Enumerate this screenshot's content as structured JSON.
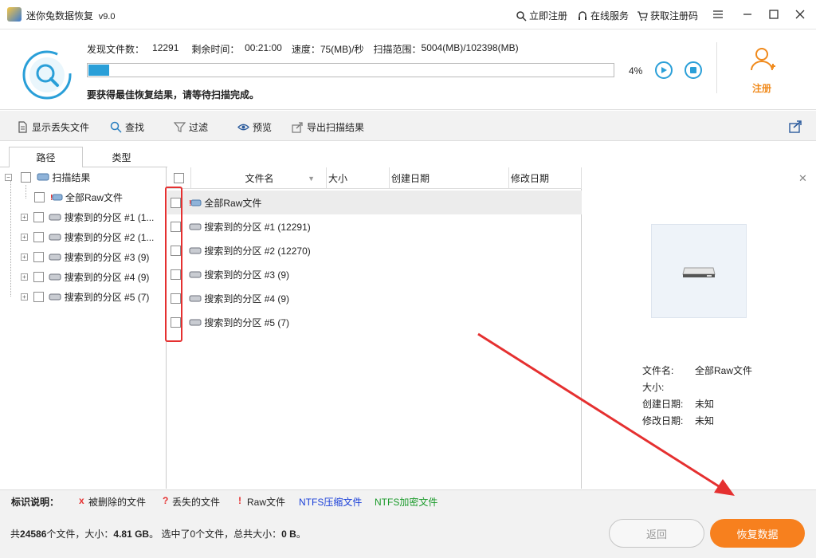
{
  "window": {
    "title": "迷你兔数据恢复",
    "version": "v9.0"
  },
  "title_links": {
    "register": "立即注册",
    "online_service": "在线服务",
    "get_code": "获取注册码"
  },
  "scan": {
    "found_label": "发现文件数：",
    "found_value": "12291",
    "remaining_label": "剩余时间：",
    "remaining_value": "00:21:00",
    "speed_label": "速度：",
    "speed_value": "75(MB)/秒",
    "range_label": "扫描范围：",
    "range_value": "5004(MB)/102398(MB)",
    "progress": 0.04,
    "progress_text": "4%",
    "hint": "要获得最佳恢复结果，请等待扫描完成。"
  },
  "register_label": "注册",
  "toolbar": {
    "show_lost": "显示丢失文件",
    "find": "查找",
    "filter": "过滤",
    "preview": "预览",
    "export": "导出扫描结果"
  },
  "tabs": {
    "path": "路径",
    "type": "类型"
  },
  "tree": {
    "root": "扫描结果",
    "items": [
      "全部Raw文件",
      "搜索到的分区 #1 (1...",
      "搜索到的分区 #2 (1...",
      "搜索到的分区 #3 (9)",
      "搜索到的分区 #4 (9)",
      "搜索到的分区 #5 (7)"
    ]
  },
  "list": {
    "columns": {
      "name": "文件名",
      "size": "大小",
      "created": "创建日期",
      "modified": "修改日期"
    },
    "rows": [
      "全部Raw文件",
      "搜索到的分区 #1 (12291)",
      "搜索到的分区 #2 (12270)",
      "搜索到的分区 #3 (9)",
      "搜索到的分区 #4 (9)",
      "搜索到的分区 #5 (7)"
    ]
  },
  "preview": {
    "name_label": "文件名:",
    "name_value": "全部Raw文件",
    "size_label": "大小:",
    "size_value": "",
    "created_label": "创建日期:",
    "created_value": "未知",
    "modified_label": "修改日期:",
    "modified_value": "未知"
  },
  "legend": {
    "title": "标识说明：",
    "deleted_mark": "x",
    "deleted": "被删除的文件",
    "lost_mark": "?",
    "lost": "丢失的文件",
    "raw_mark": "!",
    "raw": "Raw文件",
    "ntfs_comp": "NTFS压缩文件",
    "ntfs_enc": "NTFS加密文件"
  },
  "status": {
    "prefix": "共",
    "total_files": "24586",
    "files_size_text": "个文件，大小：",
    "size": "4.81 GB",
    "selected_text": "。 选中了0个文件，总共大小：",
    "selected_size": "0 B",
    "end": "。"
  },
  "buttons": {
    "back": "返回",
    "recover": "恢复数据"
  },
  "colors": {
    "accent": "#2a9fd8",
    "orange": "#f7801e",
    "annotation": "#e53030"
  }
}
